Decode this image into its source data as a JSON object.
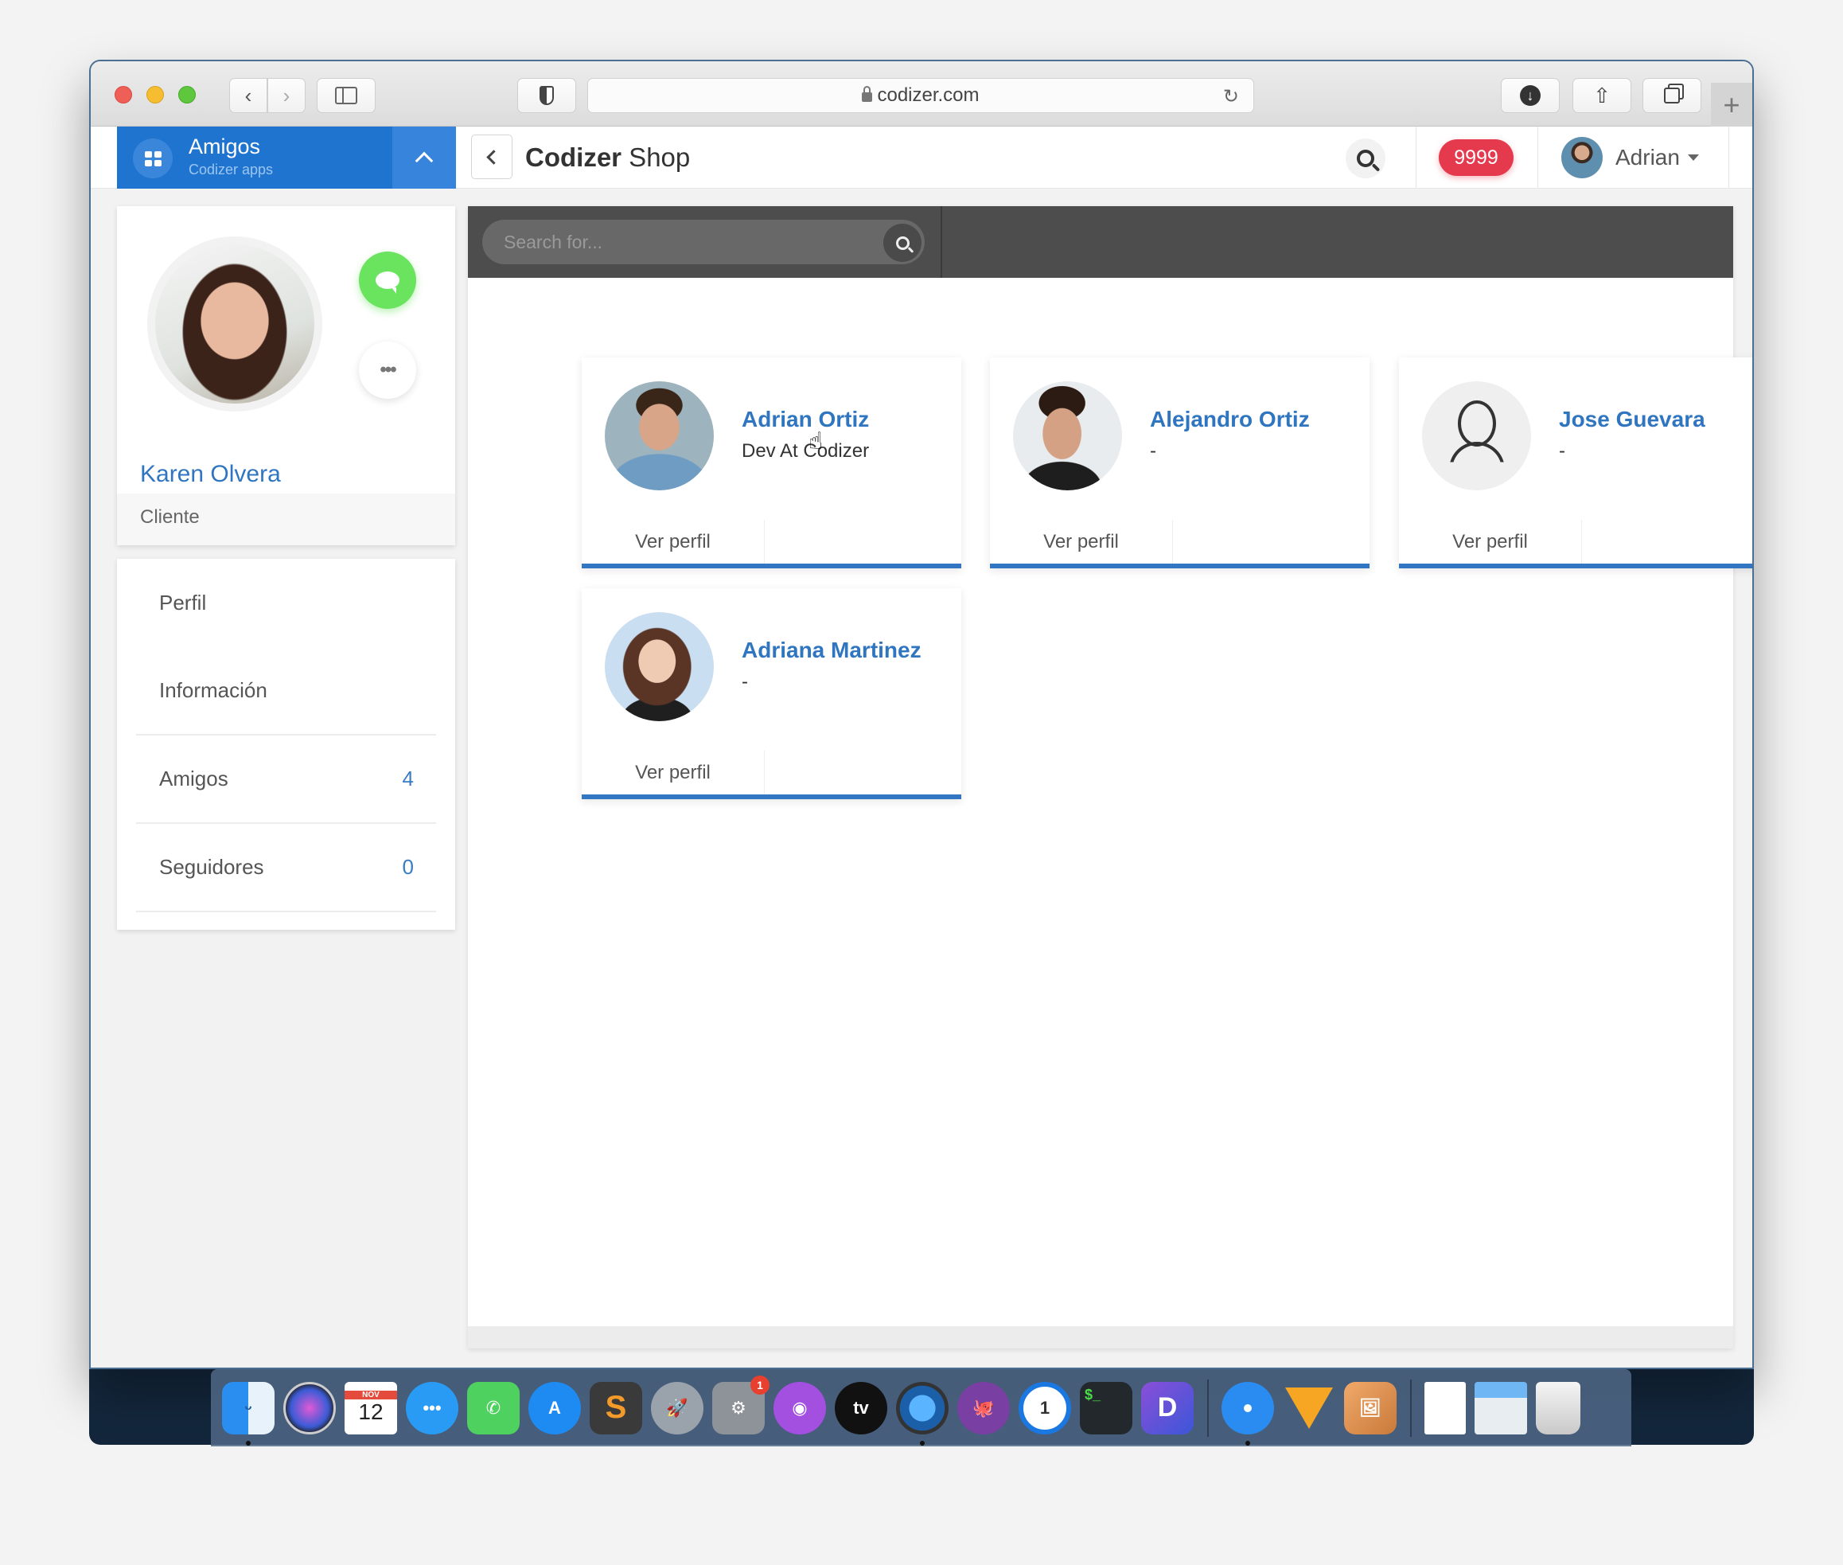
{
  "browser": {
    "url": "codizer.com",
    "new_tab_label": "+"
  },
  "app_header": {
    "section_title": "Amigos",
    "section_subtitle": "Codizer apps",
    "page_title_bold": "Codizer",
    "page_title_rest": " Shop",
    "notification_count": "9999",
    "user_name": "Adrian"
  },
  "profile": {
    "name": "Karen Olvera",
    "role": "Cliente"
  },
  "menu": {
    "items": [
      {
        "label": "Perfil",
        "count": ""
      },
      {
        "label": "Información",
        "count": ""
      },
      {
        "label": "Amigos",
        "count": "4"
      },
      {
        "label": "Seguidores",
        "count": "0"
      }
    ]
  },
  "search": {
    "placeholder": "Search for..."
  },
  "friends": [
    {
      "name": "Adrian Ortiz",
      "subtitle": "Dev At Codizer",
      "action": "Ver perfil"
    },
    {
      "name": "Alejandro Ortiz",
      "subtitle": "-",
      "action": "Ver perfil"
    },
    {
      "name": "Jose Guevara",
      "subtitle": "-",
      "action": "Ver perfil"
    },
    {
      "name": "Adriana Martinez",
      "subtitle": "-",
      "action": "Ver perfil"
    }
  ],
  "dock": {
    "calendar_month": "NOV",
    "calendar_day": "12",
    "system_prefs_badge": "1",
    "tv_label": "tv",
    "terminal_label": "$_",
    "dash_label": "D"
  },
  "colors": {
    "brand_blue": "#1f74d0",
    "link_blue": "#2f75c0",
    "badge_red": "#e5394d",
    "chat_green": "#6ae35f",
    "search_bar_dark": "#4d4d4d"
  }
}
